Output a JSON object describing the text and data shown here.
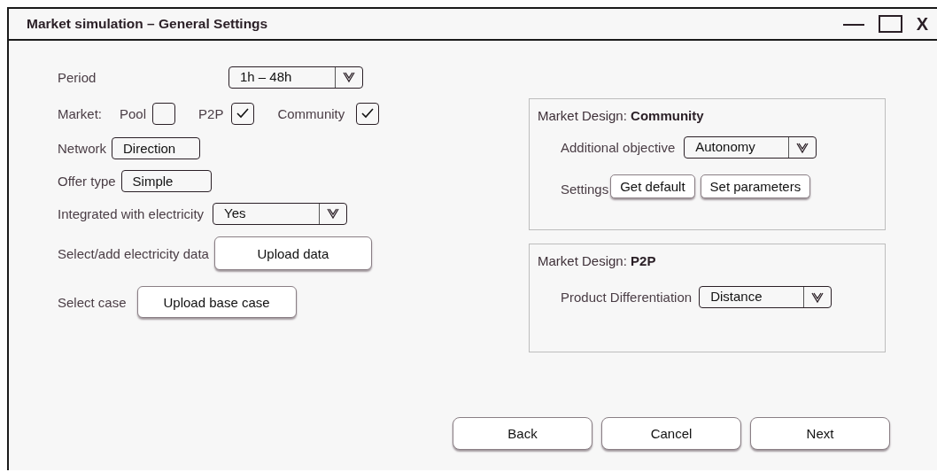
{
  "window": {
    "title": "Market simulation – General Settings",
    "close_label": "X"
  },
  "settings": [
    {
      "kind": "dropdown",
      "label": "Period",
      "value": "1h – 48h"
    },
    {
      "kind": "checkboxes",
      "label": "Market:",
      "options": [
        {
          "label": "Pool",
          "checked": false
        },
        {
          "label": "P2P",
          "checked": true
        },
        {
          "label": "Community",
          "checked": true
        }
      ]
    },
    {
      "kind": "box",
      "label": "Network",
      "value": "Direction"
    },
    {
      "kind": "box",
      "label": "Offer type",
      "value": "Simple"
    },
    {
      "kind": "dropdown",
      "label": "Integrated with electricity",
      "value": "Yes"
    },
    {
      "kind": "button",
      "label": "Select/add electricity data",
      "value": "Upload data"
    },
    {
      "kind": "button",
      "label": "Select case",
      "value": "Upload base case"
    }
  ],
  "panels": [
    {
      "title": "Market Design: **Community**",
      "rows": [
        {
          "kind": "dropdown",
          "label": "Additional objective",
          "value": "Autonomy"
        },
        {
          "kind": "buttons",
          "label": "Settings",
          "buttons": [
            "Get default",
            "Set parameters"
          ]
        }
      ]
    },
    {
      "title": "Market Design: **P2P**",
      "rows": [
        {
          "kind": "dropdown",
          "label": "Product Differentiation",
          "value": "Distance"
        }
      ]
    }
  ],
  "buttons": [
    "Back",
    "Cancel",
    "Next"
  ]
}
